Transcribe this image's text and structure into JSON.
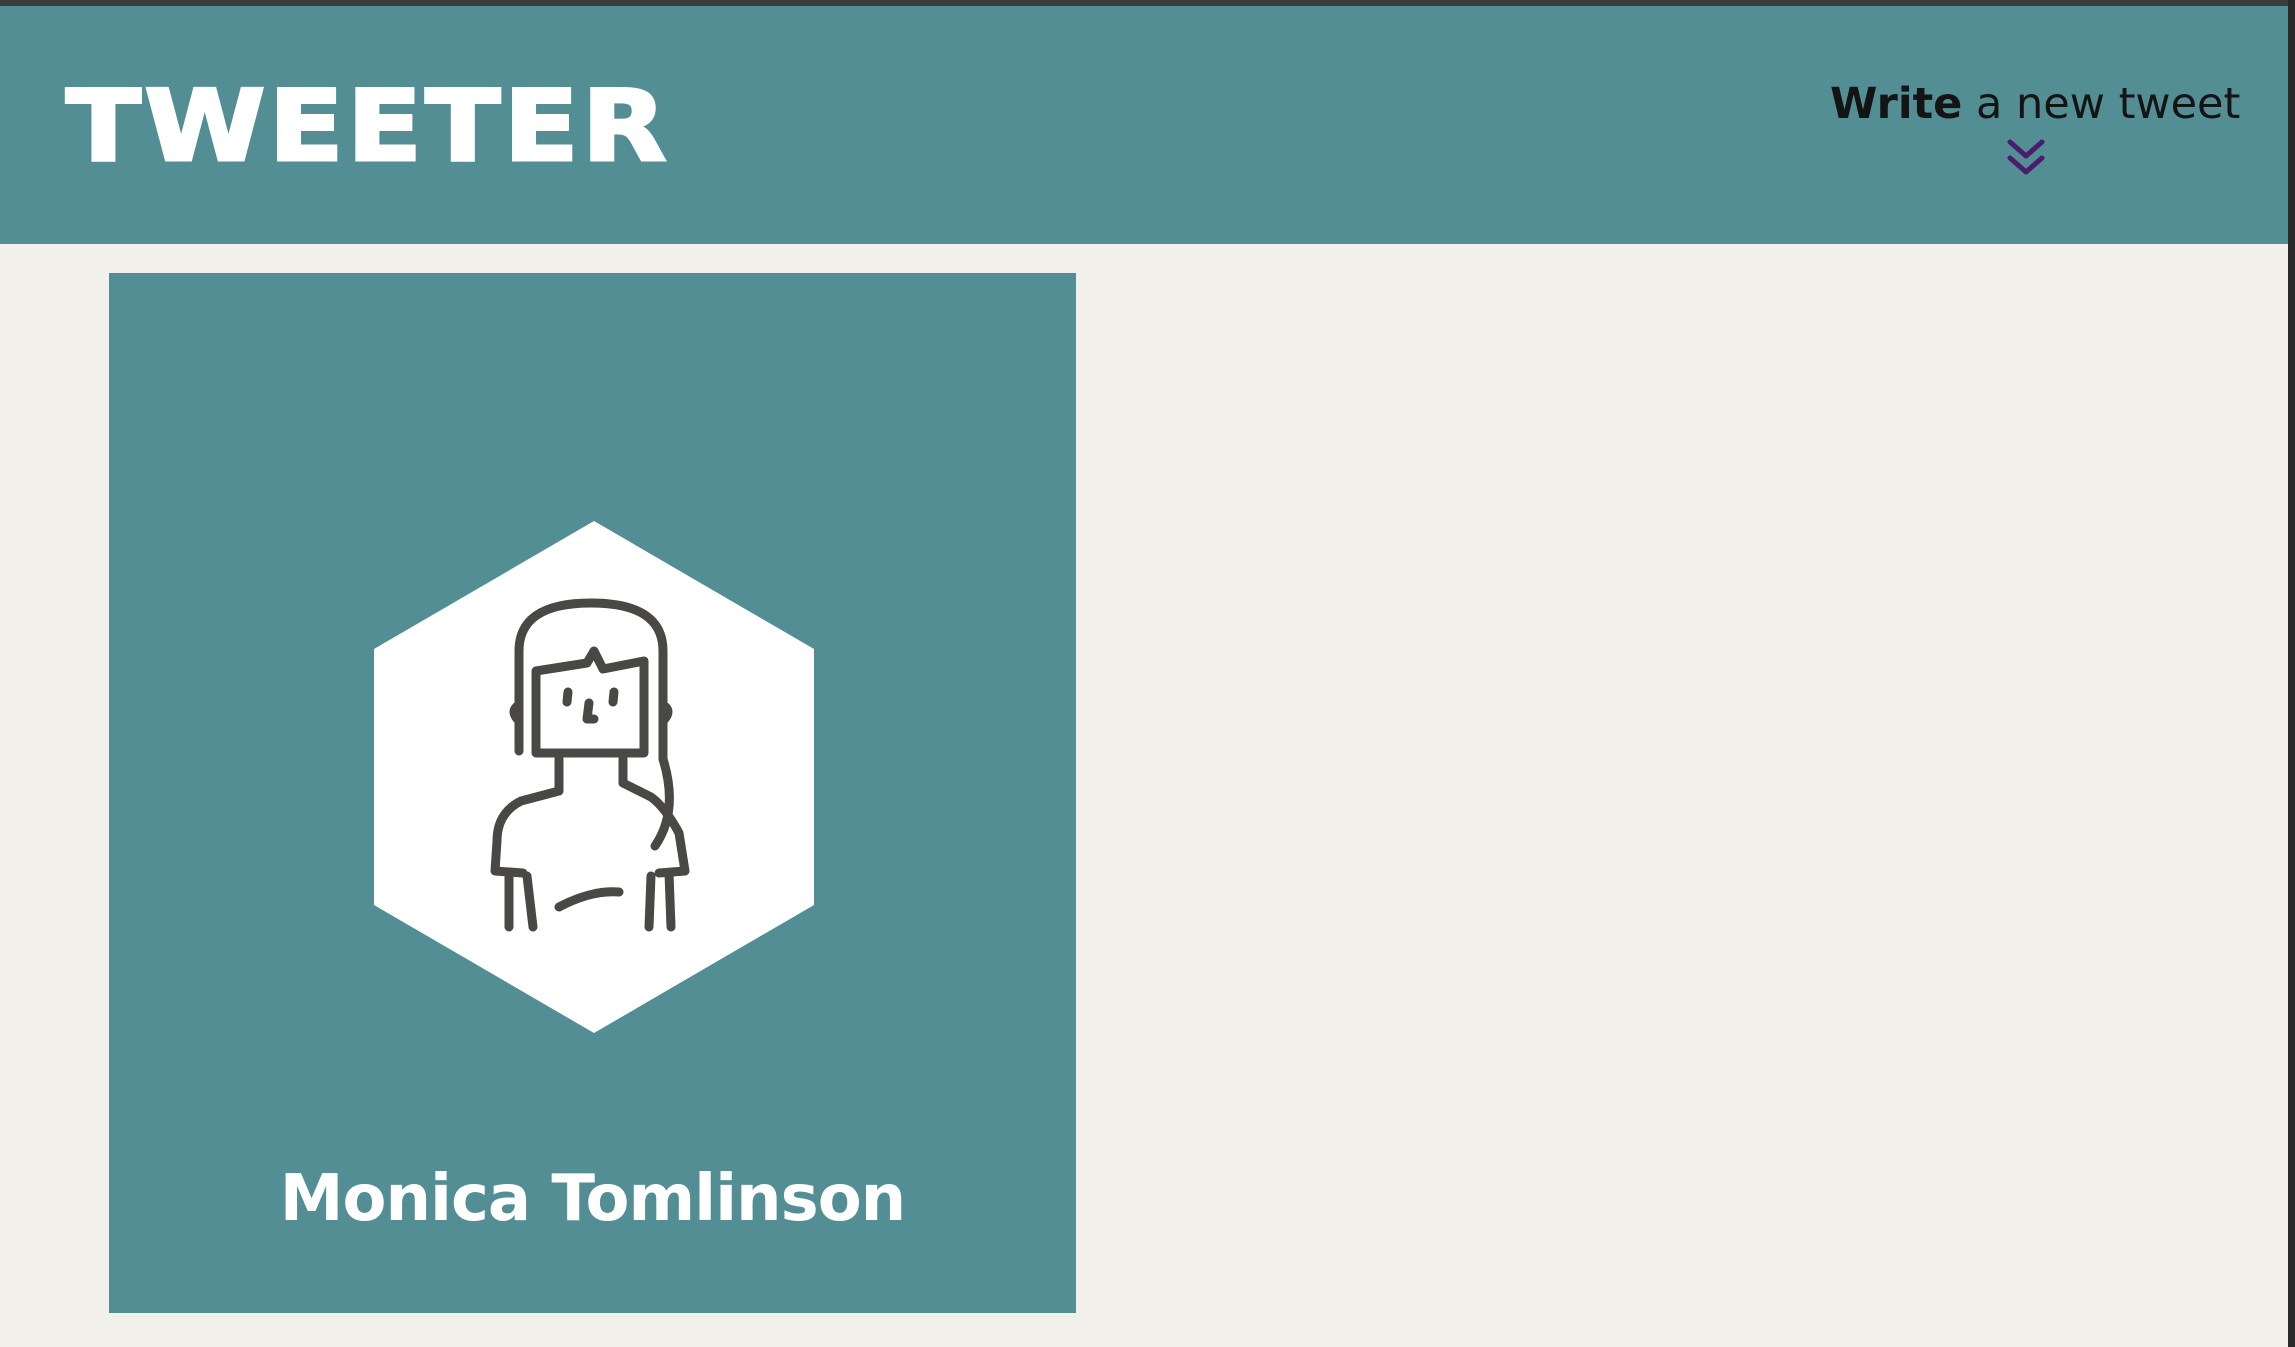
{
  "navbar": {
    "brand": "TWEETER",
    "compose": {
      "bold": "Write",
      "rest": " a new tweet",
      "icon": "double-chevron-down-icon"
    }
  },
  "profile": {
    "name": "Monica Tomlinson",
    "avatar_icon": "woman-avatar-icon"
  },
  "colors": {
    "navbar_bg": "#528e94",
    "page_bg": "#f2f0eb",
    "accent": "#4b1c6e",
    "avatar_stroke": "#4a4844"
  }
}
